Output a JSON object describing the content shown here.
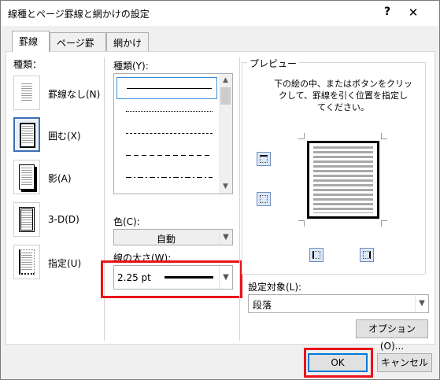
{
  "window": {
    "title": "線種とページ罫線と網かけの設定",
    "help_glyph": "?",
    "close_glyph": "✕"
  },
  "tabs": [
    "罫線",
    "ページ罫線",
    "網かけ"
  ],
  "setting": {
    "label": "種類：",
    "options": [
      "罫線なし(N)",
      "囲む(X)",
      "影(A)",
      "3-D(D)",
      "指定(U)"
    ],
    "selected": "囲む(X)"
  },
  "style": {
    "label": "種類(Y):",
    "items": [
      "solid",
      "dotted",
      "dashed-small",
      "dashed",
      "dash-dot"
    ]
  },
  "color": {
    "label": "色(C):",
    "value": "自動"
  },
  "width": {
    "label": "線の太さ(W):",
    "value": "2.25 pt"
  },
  "preview": {
    "title": "プレビュー",
    "description_line1": "下の絵の中、またはボタンをクリッ",
    "description_line2": "クして、罫線を引く位置を指定し",
    "description_line3": "てください。"
  },
  "apply_to": {
    "label": "設定対象(L):",
    "value": "段落"
  },
  "buttons": {
    "options": "オプション(O)...",
    "ok": "OK",
    "cancel": "キャンセル"
  },
  "colors": {
    "highlight": "#e8141a",
    "accent": "#0078d7"
  }
}
